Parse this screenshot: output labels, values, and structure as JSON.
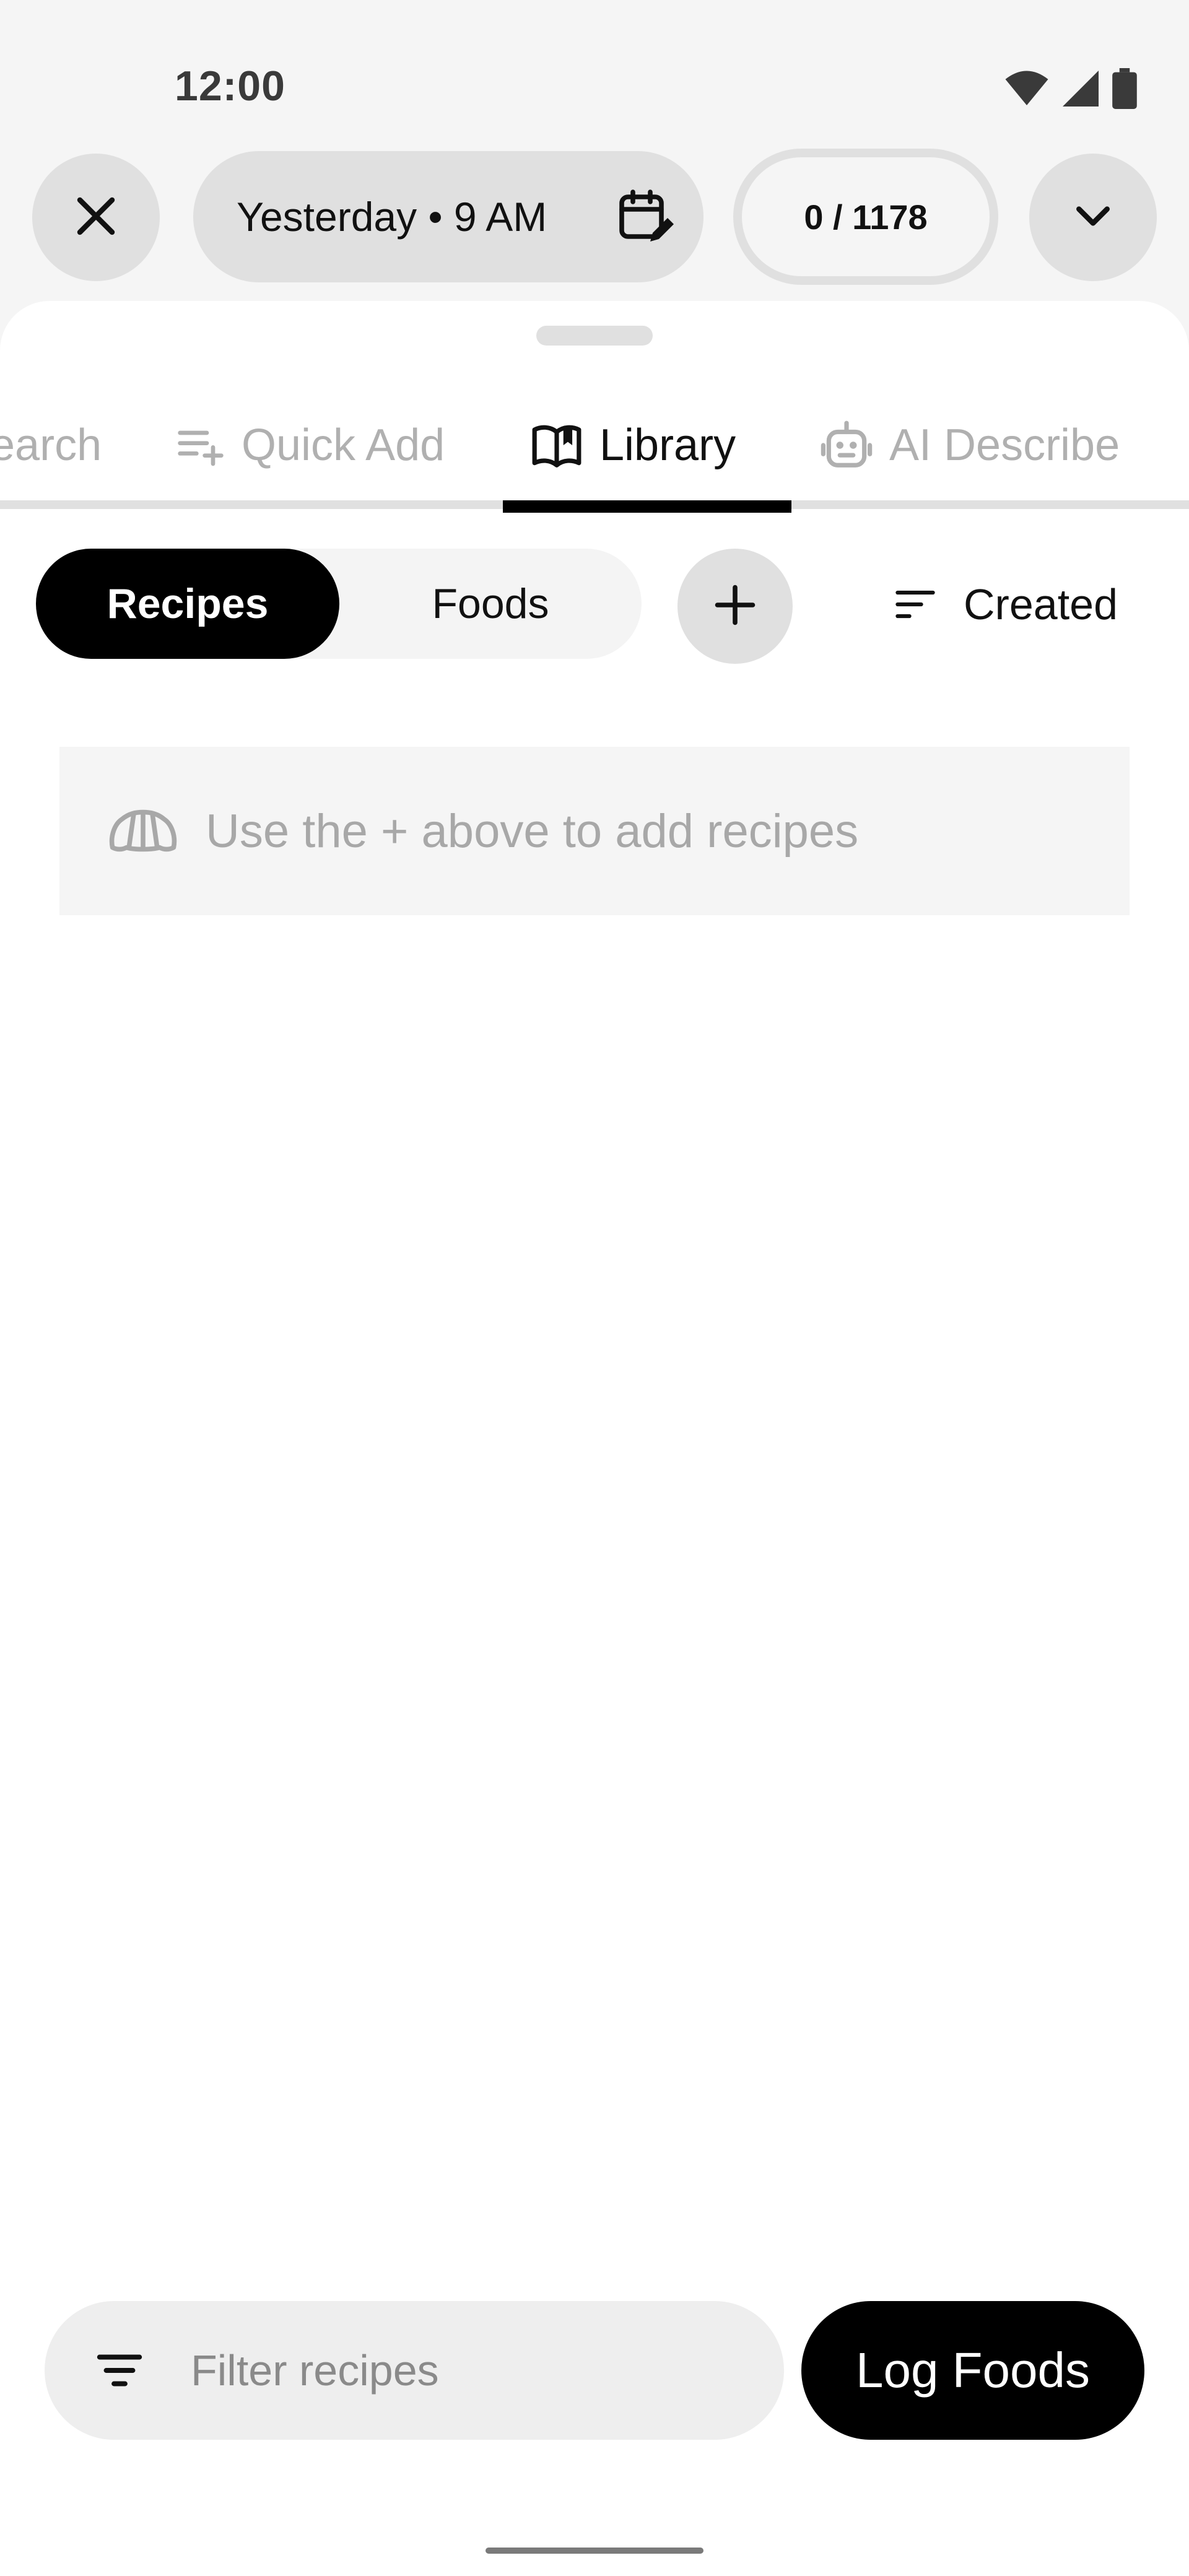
{
  "status_bar": {
    "time": "12:00"
  },
  "top_bar": {
    "date_time": "Yesterday • 9 AM",
    "counter": "0 / 1178"
  },
  "tabs": [
    {
      "label": "earch",
      "icon": "search-icon"
    },
    {
      "label": "Quick Add",
      "icon": "playlist-add-icon"
    },
    {
      "label": "Library",
      "icon": "book-open-icon",
      "selected": true
    },
    {
      "label": "AI Describe",
      "icon": "robot-icon"
    }
  ],
  "library": {
    "segments": {
      "recipes": "Recipes",
      "foods": "Foods",
      "selected": "Recipes"
    },
    "sort_label": "Created",
    "empty_message": "Use the + above to add recipes"
  },
  "bottom": {
    "filter_placeholder": "Filter recipes",
    "filter_value": "",
    "log_button": "Log Foods"
  },
  "colors": {
    "background": "#f5f5f5",
    "surface": "#ffffff",
    "control": "#e0e0e0",
    "accent": "#000000",
    "muted_text": "#b0b0b0"
  }
}
